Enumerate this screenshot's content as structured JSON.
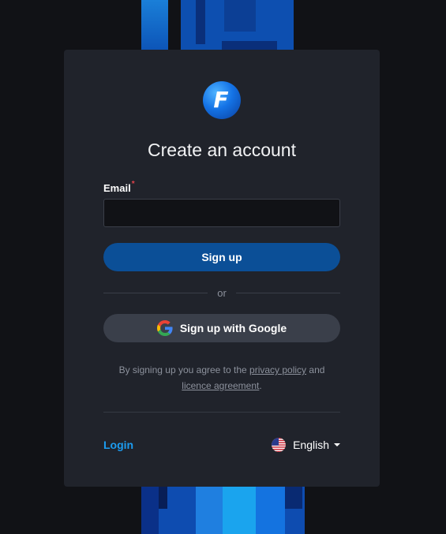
{
  "logo": {
    "letter": "F"
  },
  "title": "Create an account",
  "form": {
    "email_label": "Email",
    "required_mark": "*",
    "email_value": "",
    "signup_label": "Sign up",
    "or_label": "or",
    "google_label": "Sign up with Google"
  },
  "terms": {
    "prefix": "By signing up you agree to the ",
    "privacy_link": "privacy policy",
    "middle": " and",
    "licence_link": "licence agreement",
    "suffix": "."
  },
  "footer": {
    "login_label": "Login",
    "language": "English",
    "language_flag": "us-flag-icon"
  },
  "colors": {
    "page_bg": "#111216",
    "card_bg": "#20232b",
    "primary_button": "#0b4f97",
    "google_button": "#3a3f4a",
    "link": "#1c9cf0",
    "required": "#e0424a"
  }
}
